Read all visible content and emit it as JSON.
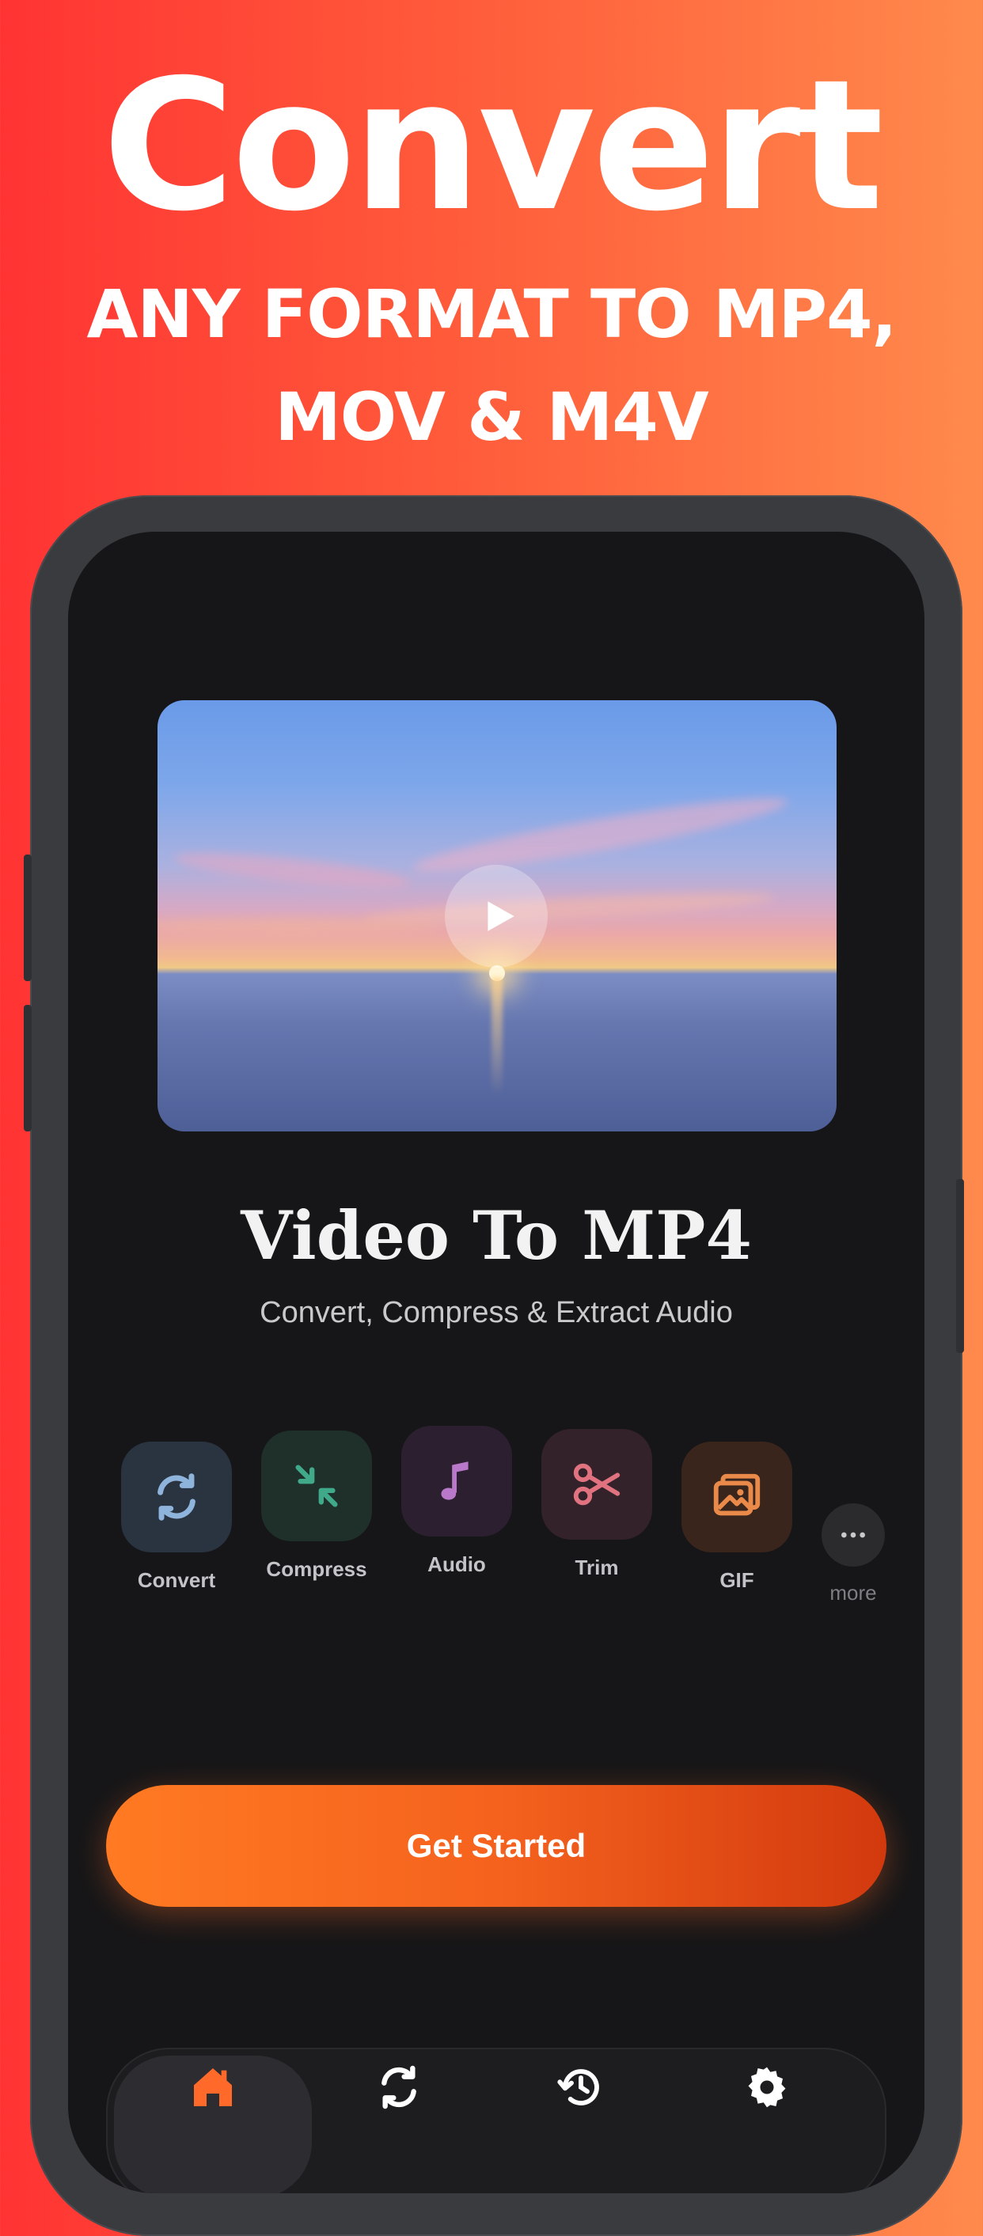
{
  "promo": {
    "title": "Convert",
    "subtitle_line1": "ANY FORMAT TO MP4,",
    "subtitle_line2": "MOV & M4V"
  },
  "app": {
    "title": "Video To MP4",
    "subtitle": "Convert, Compress & Extract Audio",
    "cta_label": "Get Started"
  },
  "tools": [
    {
      "label": "Convert",
      "icon": "convert-arrows-icon",
      "color": "#8fb4dc"
    },
    {
      "label": "Compress",
      "icon": "compress-arrows-icon",
      "color": "#3fa98a"
    },
    {
      "label": "Audio",
      "icon": "music-note-icon",
      "color": "#b978c9"
    },
    {
      "label": "Trim",
      "icon": "scissors-icon",
      "color": "#e0737f"
    },
    {
      "label": "GIF",
      "icon": "photos-icon",
      "color": "#e98a4a"
    }
  ],
  "more_label": "more",
  "tabbar": {
    "items": [
      {
        "icon": "home-icon",
        "active": true
      },
      {
        "icon": "convert-icon",
        "active": false
      },
      {
        "icon": "history-icon",
        "active": false
      },
      {
        "icon": "settings-gear-icon",
        "active": false
      }
    ],
    "accent": "#ff6a2a"
  }
}
